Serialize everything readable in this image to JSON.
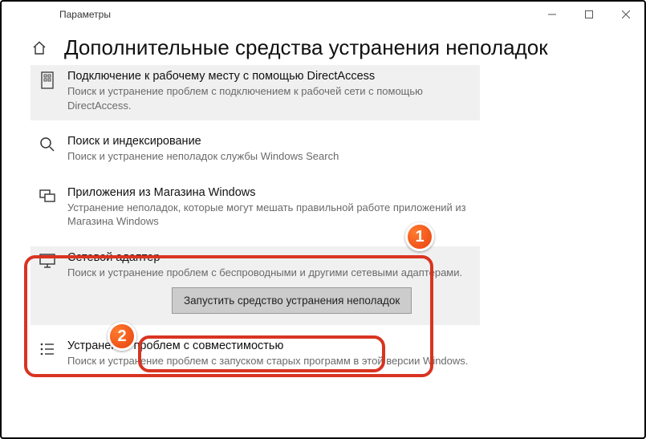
{
  "window": {
    "title": "Параметры"
  },
  "header": {
    "title": "Дополнительные средства устранения неполадок"
  },
  "items": [
    {
      "title": "Подключение к рабочему месту с помощью DirectAccess",
      "desc": "Поиск и устранение проблем с подключением к рабочей сети с помощью DirectAccess."
    },
    {
      "title": "Поиск и индексирование",
      "desc": "Поиск и устранение неполадок службы Windows Search"
    },
    {
      "title": "Приложения из Магазина Windows",
      "desc": "Устранение неполадок, которые могут мешать правильной работе приложений из Магазина Windows"
    },
    {
      "title": "Сетевой адаптер",
      "desc": "Поиск и устранение проблем с беспроводными и другими сетевыми адаптерами."
    },
    {
      "title": "Устранение проблем с совместимостью",
      "desc": "Поиск и устранение проблем с запуском старых программ в этой версии Windows."
    }
  ],
  "actions": {
    "run": "Запустить средство устранения неполадок"
  },
  "annotations": {
    "one": "1",
    "two": "2"
  }
}
